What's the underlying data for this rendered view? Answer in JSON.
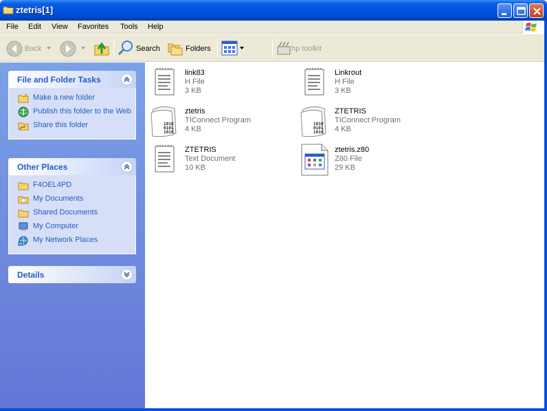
{
  "window": {
    "title": "ztetris[1]"
  },
  "menu": [
    "File",
    "Edit",
    "View",
    "Favorites",
    "Tools",
    "Help"
  ],
  "toolbar": {
    "back": "Back",
    "search": "Search",
    "folders": "Folders",
    "hp_toolkit": "hp toolkit"
  },
  "panels": {
    "tasks": {
      "title": "File and Folder Tasks",
      "items": [
        {
          "label": "Make a new folder",
          "icon": "new-folder-icon"
        },
        {
          "label": "Publish this folder to the Web",
          "icon": "publish-web-icon"
        },
        {
          "label": "Share this folder",
          "icon": "share-folder-icon"
        }
      ]
    },
    "places": {
      "title": "Other Places",
      "items": [
        {
          "label": "F4OEL4PD",
          "icon": "folder-icon"
        },
        {
          "label": "My Documents",
          "icon": "folder-icon"
        },
        {
          "label": "Shared Documents",
          "icon": "folder-icon"
        },
        {
          "label": "My Computer",
          "icon": "computer-icon"
        },
        {
          "label": "My Network Places",
          "icon": "network-icon"
        }
      ]
    },
    "details": {
      "title": "Details"
    }
  },
  "files": [
    {
      "name": "link83",
      "type": "H File",
      "size": "3 KB",
      "icon": "notepad-icon"
    },
    {
      "name": "Linkrout",
      "type": "H File",
      "size": "3 KB",
      "icon": "notepad-icon"
    },
    {
      "name": "ztetris",
      "type": "TIConnect Program",
      "size": "4 KB",
      "icon": "binary-icon"
    },
    {
      "name": "ZTETRIS",
      "type": "TIConnect Program",
      "size": "4 KB",
      "icon": "binary-icon"
    },
    {
      "name": "ZTETRIS",
      "type": "Text Document",
      "size": "10 KB",
      "icon": "notepad-icon"
    },
    {
      "name": "ztetris.z80",
      "type": "Z80 File",
      "size": "29 KB",
      "icon": "app-window-icon"
    }
  ]
}
